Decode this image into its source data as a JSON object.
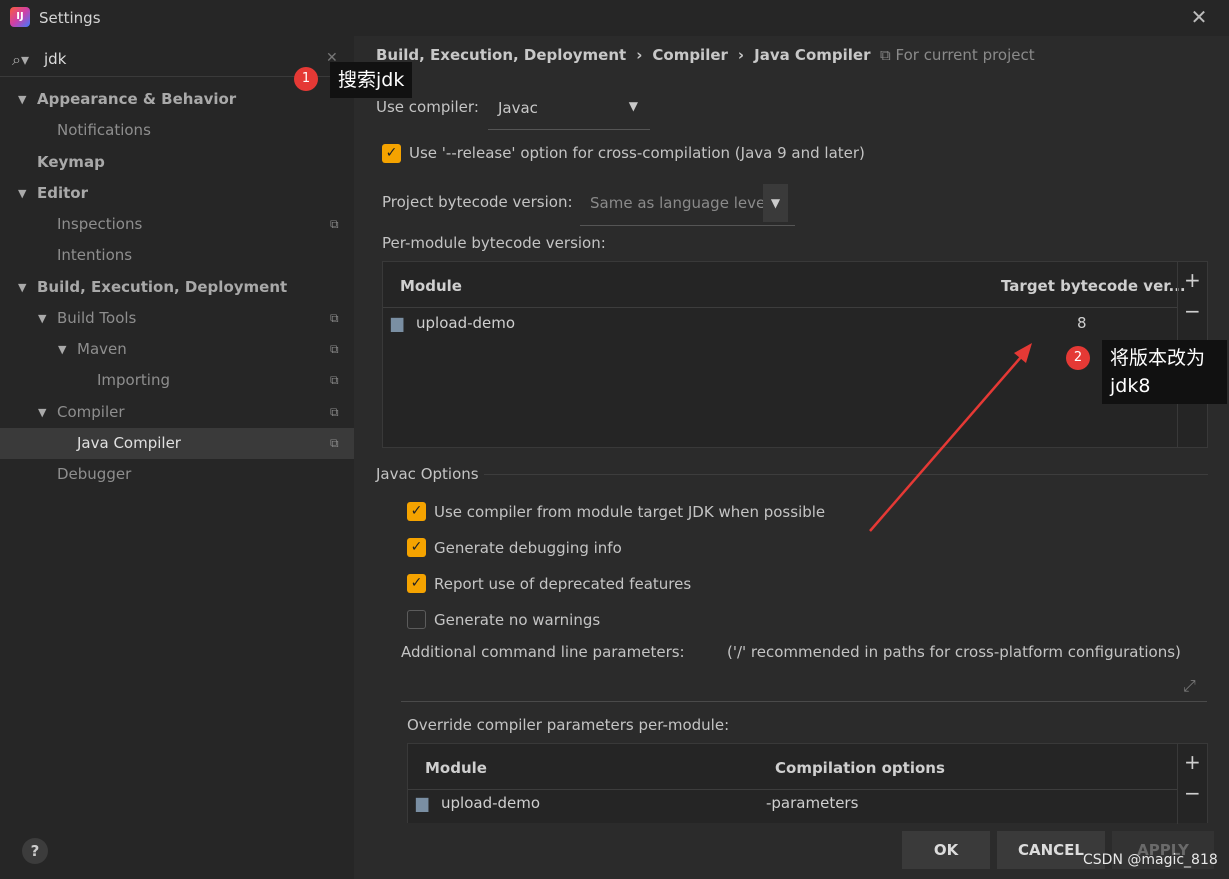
{
  "window": {
    "title": "Settings",
    "close": "✕"
  },
  "search": {
    "value": "jdk",
    "clear": "✕"
  },
  "tree": [
    {
      "label": "Appearance & Behavior",
      "arrow": "▼"
    },
    {
      "label": "Notifications"
    },
    {
      "label": "Keymap"
    },
    {
      "label": "Editor",
      "arrow": "▼"
    },
    {
      "label": "Inspections"
    },
    {
      "label": "Intentions"
    },
    {
      "label": "Build, Execution, Deployment",
      "arrow": "▼"
    },
    {
      "label": "Build Tools",
      "arrow": "▼"
    },
    {
      "label": "Maven",
      "arrow": "▼"
    },
    {
      "label": "Importing"
    },
    {
      "label": "Compiler",
      "arrow": "▼"
    },
    {
      "label": "Java Compiler"
    },
    {
      "label": "Debugger"
    }
  ],
  "breadcrumb": {
    "a": "Build, Execution, Deployment",
    "sep": "›",
    "b": "Compiler",
    "c": "Java Compiler"
  },
  "for_project": "For current project",
  "compiler": {
    "label": "Use compiler:",
    "value": "Javac"
  },
  "release_option": "Use '--release' option for cross-compilation (Java 9 and later)",
  "bytecode": {
    "label": "Project bytecode version:",
    "value": "Same as language level"
  },
  "per_module": {
    "label": "Per-module bytecode version:",
    "col_module": "Module",
    "col_target": "Target bytecode ver...",
    "row_module": "upload-demo",
    "row_target": "8"
  },
  "javac": {
    "title": "Javac Options",
    "opt1": "Use compiler from module target JDK when possible",
    "opt2": "Generate debugging info",
    "opt3": "Report use of deprecated features",
    "opt4": "Generate no warnings",
    "params_label": "Additional command line parameters:",
    "params_hint": "('/' recommended in paths for cross-platform configurations)"
  },
  "override": {
    "label": "Override compiler parameters per-module:",
    "col_module": "Module",
    "col_options": "Compilation options",
    "row_module": "upload-demo",
    "row_options": "-parameters"
  },
  "buttons": {
    "ok": "OK",
    "cancel": "CANCEL",
    "apply": "APPLY",
    "help": "?",
    "add": "+",
    "remove": "−"
  },
  "annotations": {
    "one_num": "1",
    "one_text": "搜索jdk",
    "two_num": "2",
    "two_text_a": "将版本改为",
    "two_text_b": "jdk8"
  },
  "watermark": "CSDN @magic_818",
  "colors": {
    "accent": "#f5a300",
    "annotation": "#e53935"
  }
}
